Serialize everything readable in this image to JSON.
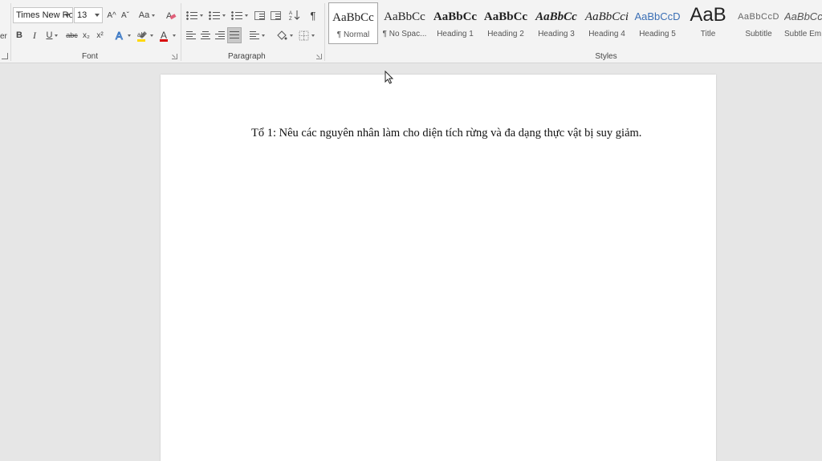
{
  "ribbon": {
    "clipboard_edge_text": "er",
    "font": {
      "name": "Times New Ro",
      "size": "13",
      "grow_label": "A^",
      "shrink_label": "Aˇ",
      "case_label": "Aa",
      "bold": "B",
      "italic": "I",
      "underline": "U",
      "strike": "abc",
      "subscript": "x₂",
      "superscript": "x²",
      "group_label": "Font",
      "highlight_color": "#ffd800",
      "font_color": "#d80000"
    },
    "paragraph": {
      "pilcrow": "¶",
      "group_label": "Paragraph"
    },
    "styles": {
      "group_label": "Styles",
      "items": [
        {
          "sample": "AaBbCc",
          "name": "¶ Normal"
        },
        {
          "sample": "AaBbCc",
          "name": "¶ No Spac..."
        },
        {
          "sample": "AaBbCc",
          "name": "Heading 1"
        },
        {
          "sample": "AaBbCc",
          "name": "Heading 2"
        },
        {
          "sample": "AaBbCc",
          "name": "Heading 3"
        },
        {
          "sample": "AaBbCci",
          "name": "Heading 4"
        },
        {
          "sample": "AaBbCcD",
          "name": "Heading 5"
        },
        {
          "sample": "AaB",
          "name": "Title"
        },
        {
          "sample": "AaBbCcD",
          "name": "Subtitle"
        },
        {
          "sample": "AaBbCc",
          "name": "Subtle Em"
        }
      ]
    }
  },
  "document": {
    "text": "Tổ 1: Nêu các nguyên nhân làm cho diện tích rừng và đa dạng thực vật bị suy giảm."
  }
}
